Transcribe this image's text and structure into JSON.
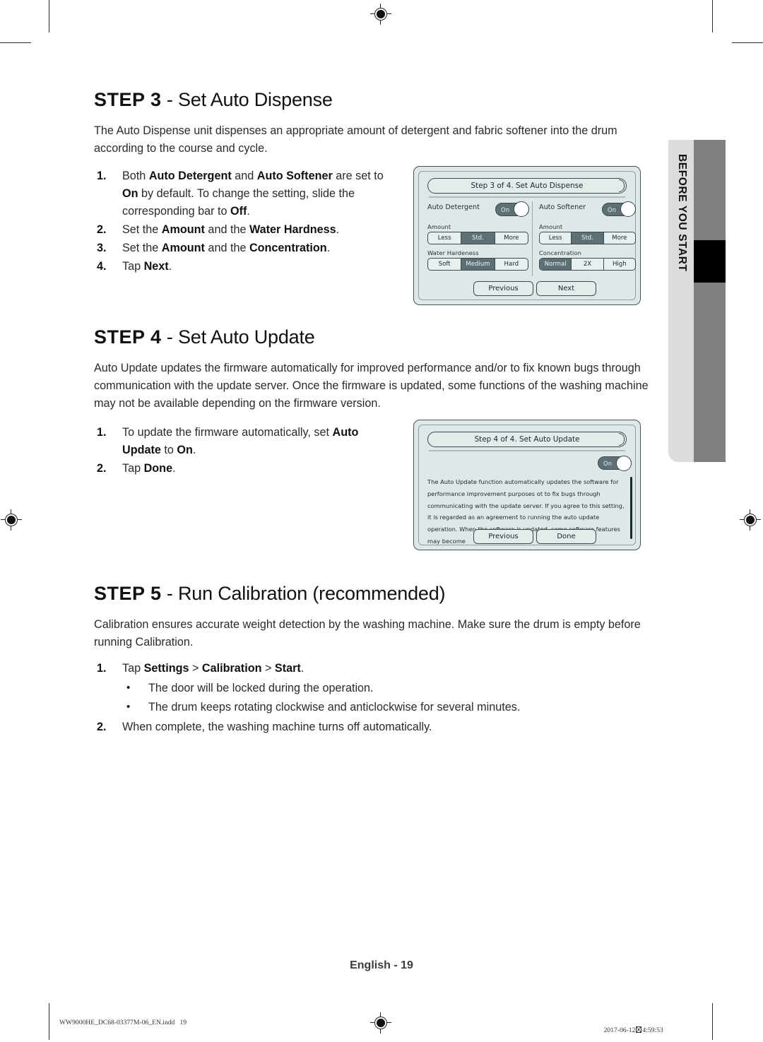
{
  "document": {
    "page_footer": "English - 19",
    "print_footer_left": "WW9000HE_DC68-03377M-06_EN.indd   19",
    "print_footer_right_date": "2017-06-12",
    "print_footer_right_time": "4:59:53"
  },
  "side_tab": {
    "label": "BEFORE YOU START"
  },
  "sections": [
    {
      "heading_prefix": "STEP 3",
      "heading_rest": " - Set Auto Dispense",
      "intro": "The Auto Dispense unit dispenses an appropriate amount of detergent and fabric softener into the drum according to the course and cycle.",
      "steps": [
        "1.",
        "2.",
        "3.",
        "4."
      ]
    },
    {
      "heading_prefix": "STEP 4",
      "heading_rest": " - Set Auto Update",
      "intro": "Auto Update updates the firmware automatically for improved performance and/or to fix known bugs through communication with the update server. Once the firmware is updated, some functions of the washing machine may not be available depending on the firmware version."
    },
    {
      "heading_prefix": "STEP 5",
      "heading_rest": " - Run Calibration (recommended)",
      "intro": "Calibration ensures accurate weight detection by the washing machine. Make sure the drum is empty before running Calibration."
    }
  ],
  "step3_list": {
    "n1": "1.",
    "n2": "2.",
    "n3": "3.",
    "n4": "4.",
    "item1_a": "Both ",
    "item1_b1": "Auto Detergent",
    "item1_c": " and ",
    "item1_b2": "Auto Softener",
    "item1_d": " are set to ",
    "item1_b3": "On",
    "item1_e": " by default. To change the setting, slide the corresponding bar to ",
    "item1_b4": "Off",
    "item1_f": ".",
    "item2_a": "Set the ",
    "item2_b1": "Amount",
    "item2_c": " and the ",
    "item2_b2": "Water Hardness",
    "item2_d": ".",
    "item3_a": "Set the ",
    "item3_b1": "Amount",
    "item3_c": " and the ",
    "item3_b2": "Concentration",
    "item3_d": ".",
    "item4_a": "Tap ",
    "item4_b1": "Next",
    "item4_c": "."
  },
  "step4_list": {
    "n1": "1.",
    "n2": "2.",
    "item1_a": "To update the firmware automatically, set ",
    "item1_b1": "Auto Update",
    "item1_c": " to ",
    "item1_b2": "On",
    "item1_d": ".",
    "item2_a": "Tap ",
    "item2_b1": "Done",
    "item2_c": "."
  },
  "step5_list": {
    "n1": "1.",
    "n2": "2.",
    "item1_a": "Tap ",
    "item1_b1": "Settings",
    "item1_sep1": " > ",
    "item1_b2": "Calibration",
    "item1_sep2": " > ",
    "item1_b3": "Start",
    "item1_d": ".",
    "bullet_glyph": "•",
    "bullet1": "The door will be locked during the operation.",
    "bullet2": "The drum keeps rotating clockwise and anticlockwise for several minutes.",
    "item2": "When complete, the washing machine turns off automatically."
  },
  "panel_dispense": {
    "header": "Step 3 of 4. Set Auto Dispense",
    "left": {
      "title": "Auto Detergent",
      "toggle_label": "On",
      "amount_label": "Amount",
      "amount_options": [
        "Less",
        "Std.",
        "More"
      ],
      "amount_selected": "Std.",
      "second_label": "Water Hardeness",
      "second_options": [
        "Soft",
        "Medium",
        "Hard"
      ],
      "second_selected": "Medium"
    },
    "right": {
      "title": "Auto Softener",
      "toggle_label": "On",
      "amount_label": "Amount",
      "amount_options": [
        "Less",
        "Std.",
        "More"
      ],
      "amount_selected": "Std.",
      "second_label": "Concentration",
      "second_options": [
        "Normal",
        "2X",
        "High"
      ],
      "second_selected": "Normal"
    },
    "buttons": {
      "previous": "Previous",
      "next": "Next"
    }
  },
  "panel_update": {
    "header": "Step 4 of 4. Set Auto Update",
    "toggle_label": "On",
    "body": "The Auto Update function automatically updates the software for performance improvement purposes ot to fix bugs through communicating with the update server. If you agree to this setting, it is regarded as an agreement to running the auto update operation. When the software is updated, some software features may become",
    "buttons": {
      "previous": "Previous",
      "done": "Done"
    }
  },
  "colors": {
    "panel_bg": "#dfe8e8",
    "panel_border": "#4a5356",
    "accent_selected": "#5d7076",
    "side_tab_gray": "#808080",
    "side_tab_light": "#dcdcdc"
  }
}
